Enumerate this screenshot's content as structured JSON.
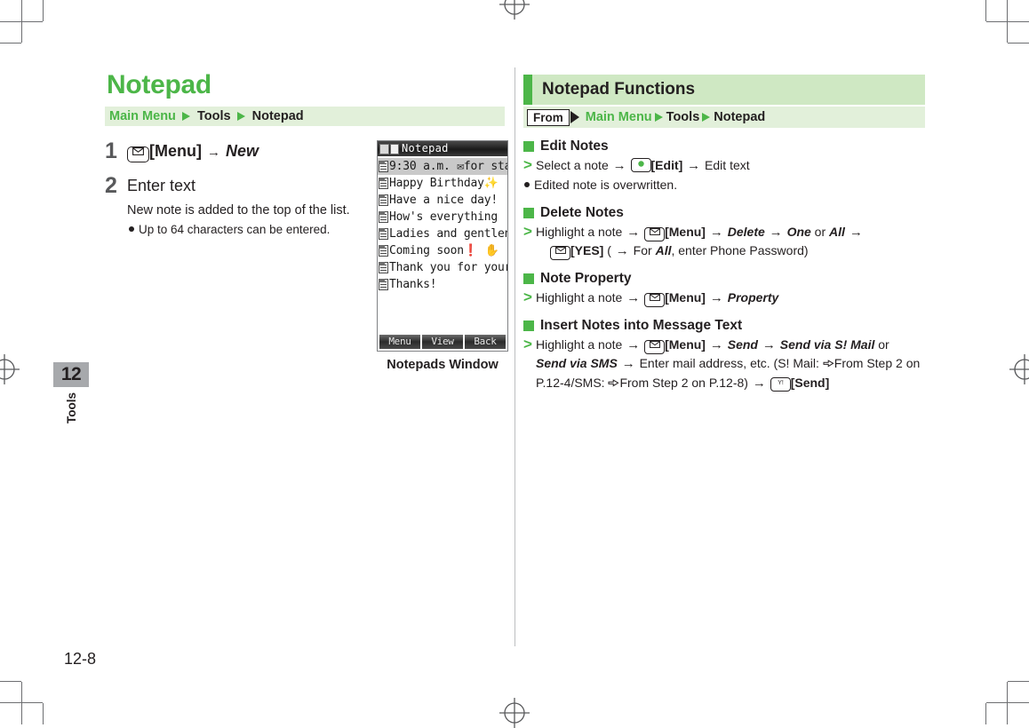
{
  "page": {
    "number": "12-8",
    "chapter_number": "12",
    "chapter_name": "Tools"
  },
  "left": {
    "title": "Notepad",
    "breadcrumb": {
      "items": [
        "Main Menu",
        "Tools",
        "Notepad"
      ],
      "separator_icon": "triangle-right-icon"
    },
    "steps": [
      {
        "number": "1",
        "key_icon": "envelope-key-icon",
        "key_label": "[Menu]",
        "arrow": "→",
        "action": "New"
      },
      {
        "number": "2",
        "heading": "Enter text",
        "sub": "New note is added to the top of the list.",
        "bullet": "Up to 64 characters can be entered."
      }
    ],
    "phone": {
      "title": "Notepad",
      "caption": "Notepads Window",
      "list": [
        {
          "text": "9:30 a.m. ✉for sta",
          "selected": true
        },
        {
          "text": "Happy Birthday✨",
          "selected": false
        },
        {
          "text": "Have a nice day!",
          "selected": false
        },
        {
          "text": "How's everything",
          "selected": false
        },
        {
          "text": "Ladies and gentlen",
          "selected": false
        },
        {
          "text": "Coming soon❗ ✋",
          "selected": false
        },
        {
          "text": "Thank you for your",
          "selected": false
        },
        {
          "text": "Thanks!",
          "selected": false
        }
      ],
      "softkeys": [
        "Menu",
        "View",
        "Back"
      ]
    }
  },
  "right": {
    "header_title": "Notepad Functions",
    "from_label": "From",
    "from_breadcrumb": [
      "Main Menu",
      "Tools",
      "Notepad"
    ],
    "sections": [
      {
        "title": "Edit Notes",
        "line_parts": [
          {
            "t": "text",
            "v": "Select a note "
          },
          {
            "t": "arrow",
            "v": "→"
          },
          {
            "t": "key",
            "v": "center-key-icon"
          },
          {
            "t": "bold",
            "v": "[Edit]"
          },
          {
            "t": "arrow",
            "v": "→"
          },
          {
            "t": "text",
            "v": "Edit text"
          }
        ],
        "note": "Edited note is overwritten."
      },
      {
        "title": "Delete Notes",
        "line_parts": [
          {
            "t": "text",
            "v": "Highlight a note "
          },
          {
            "t": "arrow",
            "v": "→"
          },
          {
            "t": "key",
            "v": "envelope-key-icon"
          },
          {
            "t": "bold",
            "v": "[Menu]"
          },
          {
            "t": "arrow",
            "v": "→"
          },
          {
            "t": "ital",
            "v": "Delete"
          },
          {
            "t": "arrow",
            "v": "→"
          },
          {
            "t": "ital",
            "v": "One"
          },
          {
            "t": "text",
            "v": " or "
          },
          {
            "t": "ital",
            "v": "All"
          },
          {
            "t": "arrow",
            "v": "→"
          },
          {
            "t": "break",
            "v": ""
          },
          {
            "t": "key",
            "v": "envelope-key-icon"
          },
          {
            "t": "bold",
            "v": "[YES]"
          },
          {
            "t": "text",
            "v": " ( "
          },
          {
            "t": "arrow",
            "v": "→"
          },
          {
            "t": "text",
            "v": "For "
          },
          {
            "t": "ital",
            "v": "All"
          },
          {
            "t": "text",
            "v": ", enter Phone Password)"
          }
        ]
      },
      {
        "title": "Note Property",
        "line_parts": [
          {
            "t": "text",
            "v": "Highlight a note "
          },
          {
            "t": "arrow",
            "v": "→"
          },
          {
            "t": "key",
            "v": "envelope-key-icon"
          },
          {
            "t": "bold",
            "v": "[Menu]"
          },
          {
            "t": "arrow",
            "v": "→"
          },
          {
            "t": "ital",
            "v": "Property"
          }
        ]
      },
      {
        "title": "Insert Notes into Message Text",
        "line_parts": [
          {
            "t": "text",
            "v": "Highlight a note "
          },
          {
            "t": "arrow",
            "v": "→"
          },
          {
            "t": "key",
            "v": "envelope-key-icon"
          },
          {
            "t": "bold",
            "v": "[Menu]"
          },
          {
            "t": "arrow",
            "v": "→"
          },
          {
            "t": "ital",
            "v": "Send"
          },
          {
            "t": "arrow",
            "v": "→"
          },
          {
            "t": "ital",
            "v": "Send via S! Mail"
          },
          {
            "t": "text",
            "v": " or"
          },
          {
            "t": "break",
            "v": ""
          },
          {
            "t": "ital",
            "v": "Send via SMS"
          },
          {
            "t": "arrow",
            "v": "→"
          },
          {
            "t": "text",
            "v": "Enter mail address, etc. (S! Mail: "
          },
          {
            "t": "hand",
            "v": "pointing-hand-icon"
          },
          {
            "t": "text",
            "v": "From Step 2 on"
          },
          {
            "t": "break",
            "v": ""
          },
          {
            "t": "text",
            "v": "P.12-4/SMS: "
          },
          {
            "t": "hand",
            "v": "pointing-hand-icon"
          },
          {
            "t": "text",
            "v": "From Step 2 on P.12-8) "
          },
          {
            "t": "arrow",
            "v": "→"
          },
          {
            "t": "key",
            "v": "yhot-key-icon"
          },
          {
            "t": "bold",
            "v": "[Send]"
          }
        ]
      }
    ]
  },
  "colors": {
    "brand_green": "#4cb648",
    "pale_green": "#e2f0da",
    "header_green": "#cfe8c3",
    "gray_tab": "#a7a9ac",
    "text": "#231f20"
  }
}
